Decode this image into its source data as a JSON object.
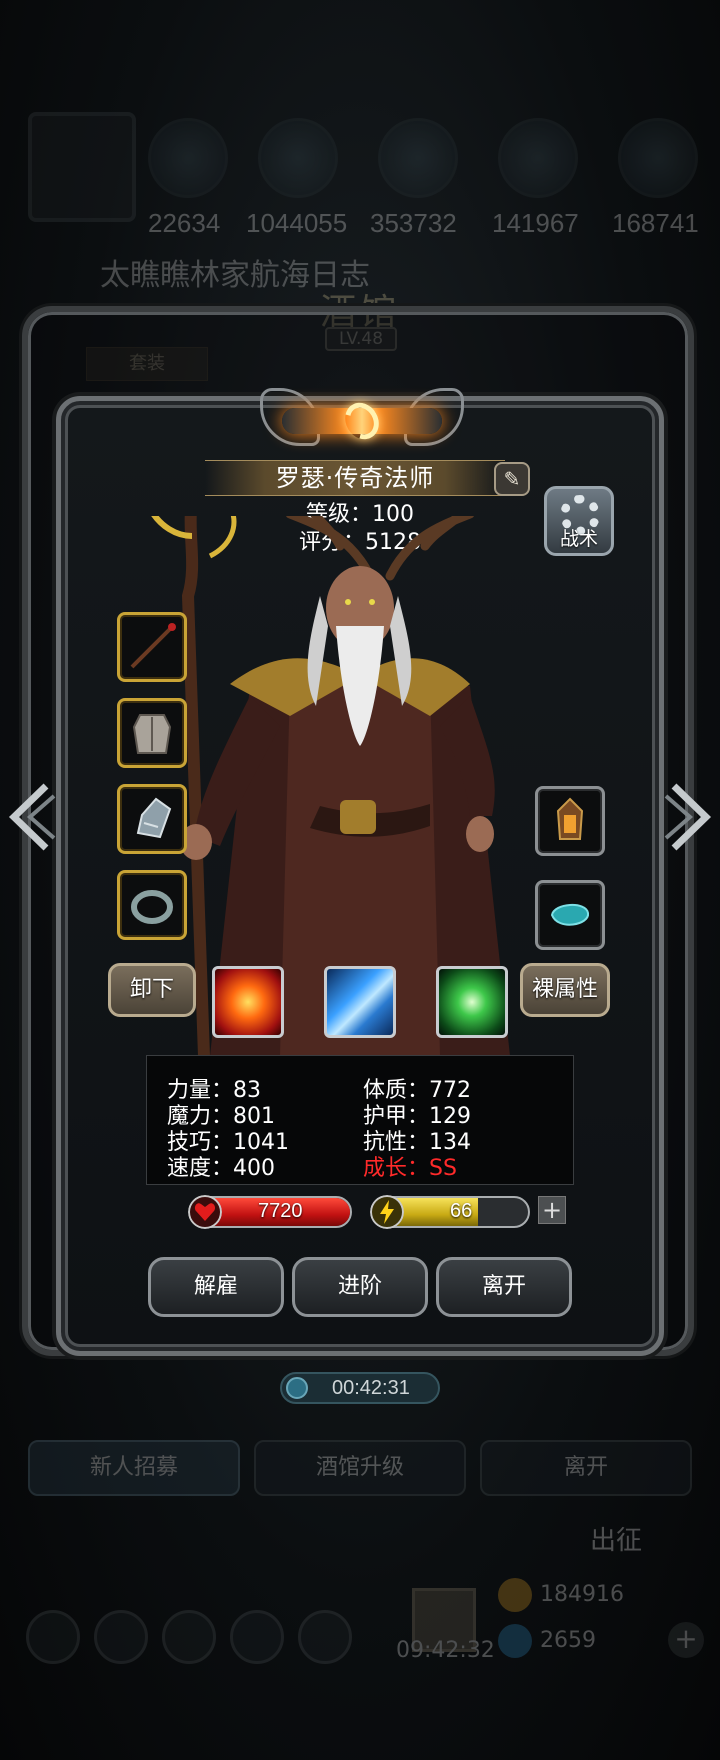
{
  "background": {
    "resources": [
      "22634",
      "1044055",
      "353732",
      "141967",
      "168741"
    ],
    "marquee": "太瞧瞧林家航海日志",
    "tavern_title": "酒馆",
    "tavern_level": "LV.48",
    "suit_tab": "套装",
    "timer": "00:42:31",
    "bottom_tabs": [
      "新人招募",
      "酒馆升级",
      "离开"
    ],
    "depart": "出征",
    "gift_timer": "09:42:32",
    "coins": [
      "184916",
      "2659"
    ]
  },
  "hero": {
    "name": "罗瑟·传奇法师",
    "level_text": "等级：100",
    "score_text": "评分：5128",
    "tactic_label": "战术"
  },
  "equipment": {
    "left": [
      "staff-icon",
      "chest-armor-icon",
      "gauntlet-icon",
      "ring-icon"
    ],
    "right": [
      "lantern-icon",
      "gem-icon"
    ]
  },
  "buttons": {
    "unequip": "卸下",
    "naked_attrs": "裸属性",
    "dismiss": "解雇",
    "advance": "进阶",
    "leave": "离开"
  },
  "skills": [
    "fire-skill-icon",
    "frost-skill-icon",
    "nature-skill-icon"
  ],
  "stats": {
    "strength": "力量：83",
    "constitution": "体质：772",
    "magic": "魔力：801",
    "armor": "护甲：129",
    "skill": "技巧：1041",
    "resistance": "抗性：134",
    "speed": "速度：400",
    "growth": "成长：SS"
  },
  "bars": {
    "hp": "7720",
    "hp_fill": 1.0,
    "energy": "66",
    "energy_fill": 0.66
  },
  "colors": {
    "hp": "#d01818",
    "energy": "#d8c020",
    "growth": "#ff2a2a",
    "slot_gold": "#c9a436"
  }
}
